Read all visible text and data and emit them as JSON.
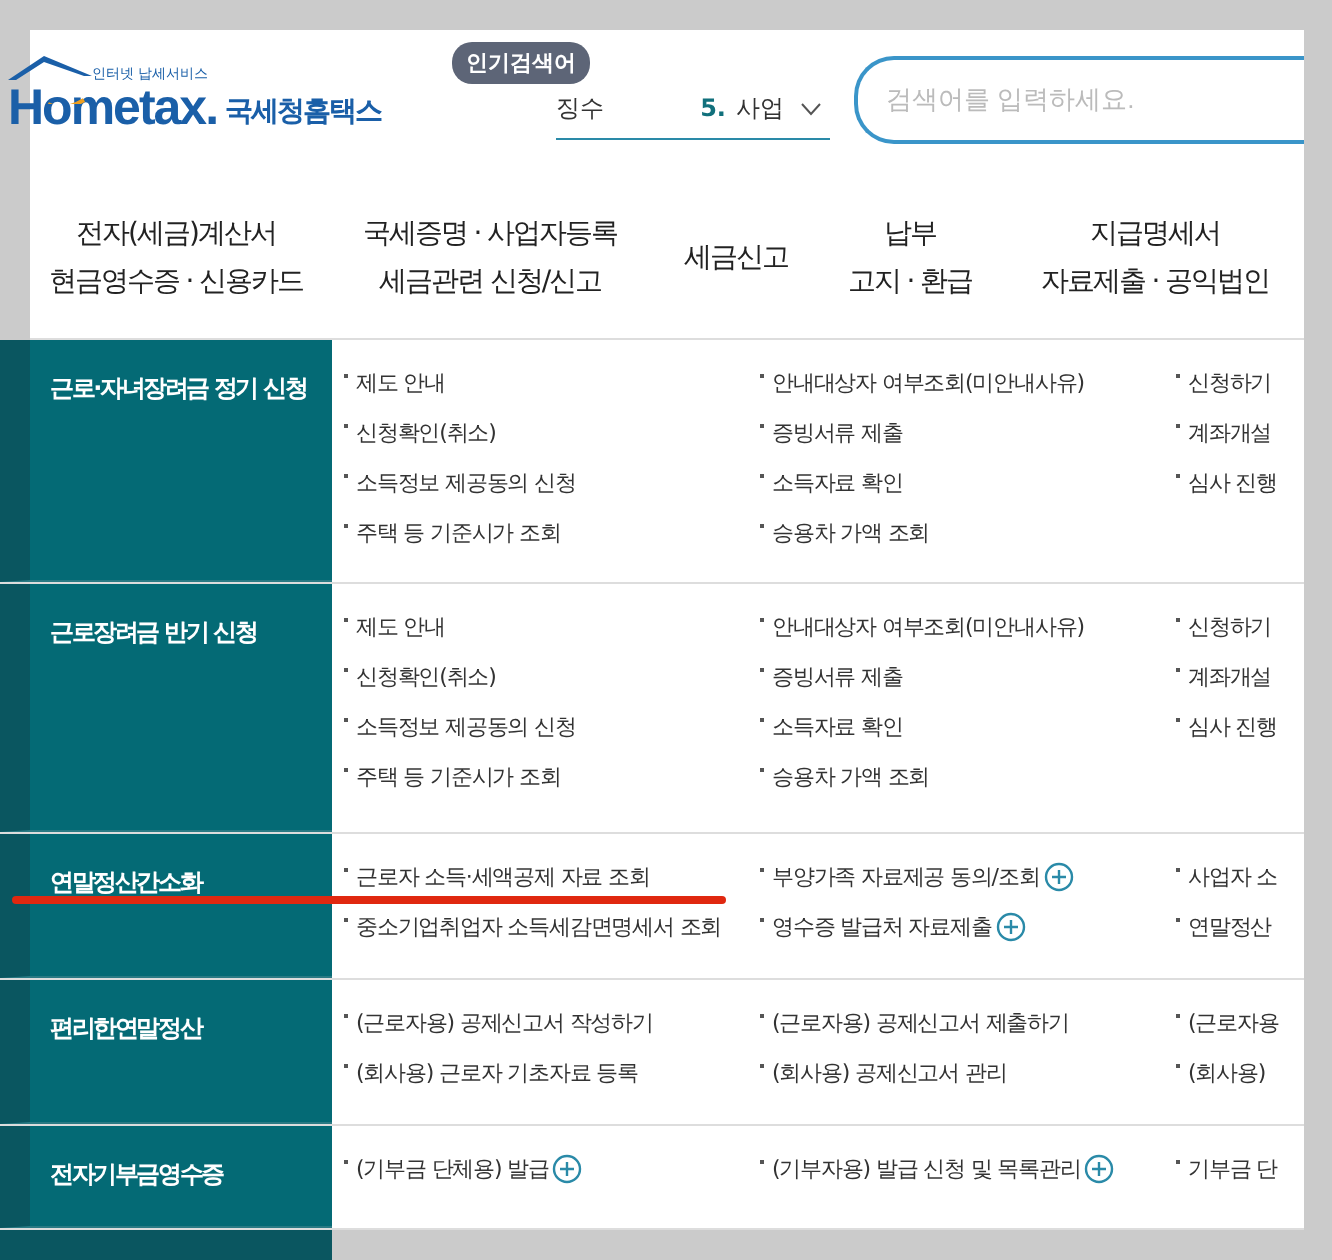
{
  "logo": {
    "tagline": "인터넷 납세서비스",
    "brand_latin": "Hometax.",
    "brand_korean": "국세청홈택스"
  },
  "popular": {
    "badge": "인기검색어",
    "prev_term": "징수",
    "rank": "5.",
    "term": "사업"
  },
  "search": {
    "placeholder": "검색어를 입력하세요."
  },
  "nav": [
    {
      "lines": [
        "전자(세금)계산서",
        "현금영수증 · 신용카드"
      ]
    },
    {
      "lines": [
        "국세증명 · 사업자등록",
        "세금관련 신청/신고"
      ]
    },
    {
      "lines": [
        "세금신고"
      ]
    },
    {
      "lines": [
        "납부",
        "고지 · 환급"
      ]
    },
    {
      "lines": [
        "지급명세서",
        "자료제출 · 공익법인"
      ]
    }
  ],
  "sections": [
    {
      "title": "근로·자녀장려금 정기 신청",
      "columns": [
        [
          {
            "label": "제도 안내"
          },
          {
            "label": "신청확인(취소)"
          },
          {
            "label": "소득정보 제공동의 신청"
          },
          {
            "label": "주택 등 기준시가 조회"
          }
        ],
        [
          {
            "label": "안내대상자 여부조회(미안내사유)"
          },
          {
            "label": "증빙서류 제출"
          },
          {
            "label": "소득자료 확인"
          },
          {
            "label": "승용차 가액 조회"
          }
        ],
        [
          {
            "label": "신청하기"
          },
          {
            "label": "계좌개설"
          },
          {
            "label": "심사 진행"
          }
        ]
      ]
    },
    {
      "title": "근로장려금 반기 신청",
      "columns": [
        [
          {
            "label": "제도 안내"
          },
          {
            "label": "신청확인(취소)"
          },
          {
            "label": "소득정보 제공동의 신청"
          },
          {
            "label": "주택 등 기준시가 조회"
          }
        ],
        [
          {
            "label": "안내대상자 여부조회(미안내사유)"
          },
          {
            "label": "증빙서류 제출"
          },
          {
            "label": "소득자료 확인"
          },
          {
            "label": "승용차 가액 조회"
          }
        ],
        [
          {
            "label": "신청하기"
          },
          {
            "label": "계좌개설"
          },
          {
            "label": "심사 진행"
          }
        ]
      ]
    },
    {
      "title": "연말정산간소화",
      "columns": [
        [
          {
            "label": "근로자 소득·세액공제 자료 조회"
          },
          {
            "label": "중소기업취업자 소득세감면명세서 조회"
          }
        ],
        [
          {
            "label": "부양가족 자료제공 동의/조회",
            "plus": true
          },
          {
            "label": "영수증 발급처 자료제출",
            "plus": true
          }
        ],
        [
          {
            "label": "사업자 소"
          },
          {
            "label": "연말정산"
          }
        ]
      ],
      "highlighted": true
    },
    {
      "title": "편리한연말정산",
      "columns": [
        [
          {
            "label": "(근로자용) 공제신고서 작성하기"
          },
          {
            "label": "(회사용) 근로자 기초자료 등록"
          }
        ],
        [
          {
            "label": "(근로자용) 공제신고서 제출하기"
          },
          {
            "label": "(회사용) 공제신고서 관리"
          }
        ],
        [
          {
            "label": "(근로자용"
          },
          {
            "label": "(회사용)"
          }
        ]
      ]
    },
    {
      "title": "전자기부금영수증",
      "columns": [
        [
          {
            "label": "(기부금 단체용) 발급",
            "plus": true
          }
        ],
        [
          {
            "label": "(기부자용) 발급 신청 및 목록관리",
            "plus": true
          }
        ],
        [
          {
            "label": "기부금 단"
          }
        ]
      ]
    }
  ]
}
